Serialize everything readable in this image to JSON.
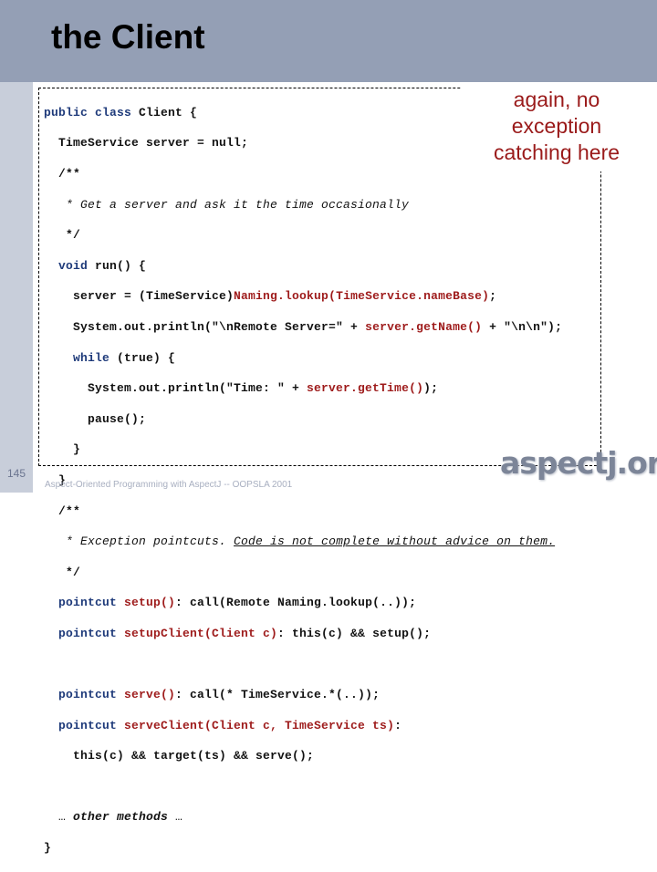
{
  "slide": {
    "title": "the Client",
    "number": "145",
    "footer": "Aspect-Oriented Programming with AspectJ -- OOPSLA 2001",
    "logo": "aspectj.org",
    "callout": [
      "again, no",
      "exception",
      "catching here"
    ],
    "colors": {
      "header": "#949fb5",
      "sidebar": "#c8ceda",
      "keyword": "#1e3a7a",
      "highlight": "#9e1b1b",
      "callout": "#9a1a1a"
    }
  },
  "code": {
    "l1_kw": "public class",
    "l1_rest": " Client {",
    "l2": "  TimeService server = null;",
    "l3": "  /**",
    "l4": "   * Get a server and ask it the time occasionally",
    "l5": "   */",
    "l6_kw": "  void",
    "l6_rest": " run() {",
    "l7_a": "    server = (TimeService)",
    "l7_b": "Naming.lookup(TimeService.nameBase)",
    "l7_c": ";",
    "l8_a": "    System.out.println(\"\\nRemote Server=\" + ",
    "l8_b": "server.getName()",
    "l8_c": " + \"\\n\\n\");",
    "l9_kw": "    while",
    "l9_rest": " (true) {",
    "l10_a": "      System.out.println(\"Time: \" + ",
    "l10_b": "server.getTime()",
    "l10_c": ");",
    "l11": "      pause();",
    "l12": "    }",
    "l13": "  }",
    "l14": "  /**",
    "l15_a": "   * Exception pointcuts. ",
    "l15_b": "Code is not complete without advice on them.",
    "l16": "   */",
    "l17_kw": "  pointcut",
    "l17_b": " setup()",
    "l17_c": ": call(Remote Naming.lookup(..));",
    "l18_kw": "  pointcut",
    "l18_b": " setupClient(Client c)",
    "l18_c": ": this(c) && setup();",
    "l19": "",
    "l20_kw": "  pointcut",
    "l20_b": " serve()",
    "l20_c": ": call(* TimeService.*(..));",
    "l21_kw": "  pointcut",
    "l21_b": " serveClient(Client c, TimeService ts)",
    "l21_c": ":",
    "l22": "    this(c) && target(ts) && serve();",
    "l23": "",
    "l24_a": "  … ",
    "l24_b": "other methods",
    "l24_c": " …",
    "l25": "}"
  }
}
